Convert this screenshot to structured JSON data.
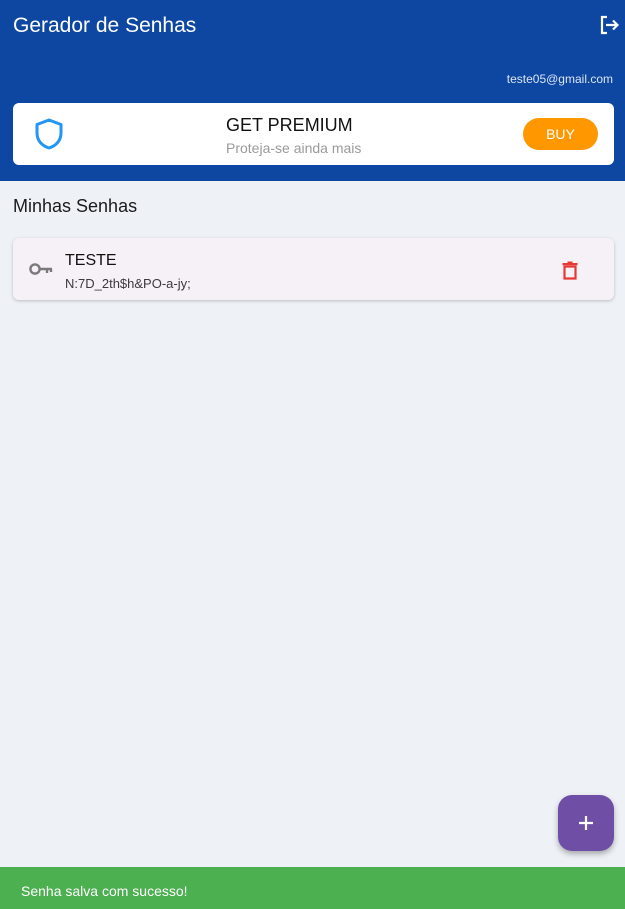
{
  "appbar": {
    "title": "Gerador de Senhas",
    "logout_icon": "logout-icon",
    "user_email": "teste05@gmail.com"
  },
  "premium": {
    "icon": "shield-icon",
    "title": "GET PREMIUM",
    "subtitle": "Proteja-se ainda mais",
    "buy_label": "BUY"
  },
  "section": {
    "title": "Minhas Senhas"
  },
  "passwords": [
    {
      "icon": "key-icon",
      "title": "TESTE",
      "value": "N:7D_2th$h&PO-a-jy;",
      "delete_icon": "trash-icon"
    }
  ],
  "fab": {
    "icon": "plus-icon"
  },
  "snackbar": {
    "message": "Senha salva com sucesso!"
  },
  "colors": {
    "primary": "#0d47a1",
    "accent": "#ff9800",
    "fab": "#6f4fa6",
    "success": "#4caf50",
    "danger": "#e53935",
    "shield": "#2196f3"
  }
}
